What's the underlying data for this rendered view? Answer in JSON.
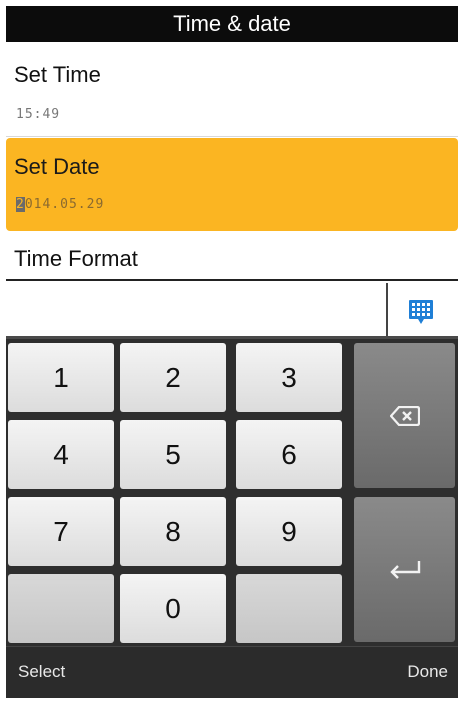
{
  "header": {
    "title": "Time & date"
  },
  "settings": {
    "time": {
      "label": "Set Time",
      "value": "15:49"
    },
    "date": {
      "label": "Set Date",
      "value_first_char": "2",
      "value_rest": "014.05.29"
    },
    "format": {
      "label": "Time Format"
    }
  },
  "input": {
    "value": ""
  },
  "keypad": {
    "keys": [
      "1",
      "2",
      "3",
      "4",
      "5",
      "6",
      "7",
      "8",
      "9",
      "0"
    ],
    "backspace_icon": "backspace-icon",
    "enter_icon": "enter-icon",
    "toggle_icon": "keyboard-grid-icon"
  },
  "softkeys": {
    "left": "Select",
    "right": "Done"
  },
  "colors": {
    "highlight": "#fbb522",
    "titlebar": "#0c0c0c",
    "keypad_bg": "#2e2e2e"
  }
}
